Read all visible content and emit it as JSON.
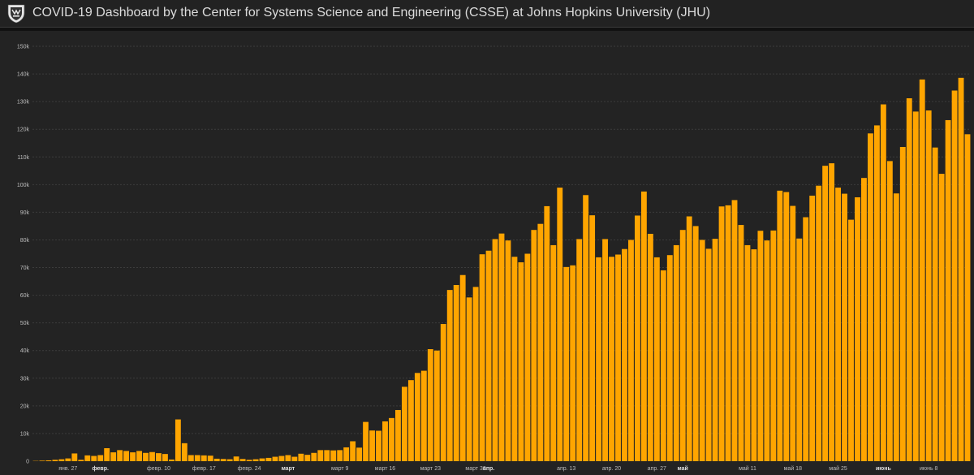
{
  "header": {
    "title": "COVID-19 Dashboard by the Center for Systems Science and Engineering (CSSE) at Johns Hopkins University (JHU)",
    "logo_icon": "jhu-shield-icon"
  },
  "colors": {
    "bar": "#FFA500",
    "background": "#232323",
    "header": "#222222"
  },
  "chart_data": {
    "type": "bar",
    "xlabel": "",
    "ylabel": "",
    "ylim": [
      0,
      150000
    ],
    "grid": true,
    "y_ticks": [
      {
        "value": 0,
        "label": "0"
      },
      {
        "value": 10000,
        "label": "10k"
      },
      {
        "value": 20000,
        "label": "20k"
      },
      {
        "value": 30000,
        "label": "30k"
      },
      {
        "value": 40000,
        "label": "40k"
      },
      {
        "value": 50000,
        "label": "50k"
      },
      {
        "value": 60000,
        "label": "60k"
      },
      {
        "value": 70000,
        "label": "70k"
      },
      {
        "value": 80000,
        "label": "80k"
      },
      {
        "value": 90000,
        "label": "90k"
      },
      {
        "value": 100000,
        "label": "100k"
      },
      {
        "value": 110000,
        "label": "110k"
      },
      {
        "value": 120000,
        "label": "120k"
      },
      {
        "value": 130000,
        "label": "130k"
      },
      {
        "value": 140000,
        "label": "140k"
      },
      {
        "value": 150000,
        "label": "150k"
      }
    ],
    "x_ticks": [
      {
        "index": 5,
        "label": "янв. 27",
        "bold": false
      },
      {
        "index": 10,
        "label": "февр.",
        "bold": true
      },
      {
        "index": 19,
        "label": "февр. 10",
        "bold": false
      },
      {
        "index": 26,
        "label": "февр. 17",
        "bold": false
      },
      {
        "index": 33,
        "label": "февр. 24",
        "bold": false
      },
      {
        "index": 39,
        "label": "март",
        "bold": true
      },
      {
        "index": 47,
        "label": "март 9",
        "bold": false
      },
      {
        "index": 54,
        "label": "март 16",
        "bold": false
      },
      {
        "index": 61,
        "label": "март 23",
        "bold": false
      },
      {
        "index": 68,
        "label": "март 30",
        "bold": false
      },
      {
        "index": 70,
        "label": "апр.",
        "bold": true
      },
      {
        "index": 82,
        "label": "апр. 13",
        "bold": false
      },
      {
        "index": 89,
        "label": "апр. 20",
        "bold": false
      },
      {
        "index": 96,
        "label": "апр. 27",
        "bold": false
      },
      {
        "index": 100,
        "label": "май",
        "bold": true
      },
      {
        "index": 110,
        "label": "май 11",
        "bold": false
      },
      {
        "index": 117,
        "label": "май 18",
        "bold": false
      },
      {
        "index": 124,
        "label": "май 25",
        "bold": false
      },
      {
        "index": 131,
        "label": "июнь",
        "bold": true
      },
      {
        "index": 138,
        "label": "июнь 8",
        "bold": false
      }
    ],
    "values": [
      100,
      200,
      300,
      500,
      700,
      1000,
      2800,
      500,
      2100,
      1900,
      2200,
      4700,
      3200,
      4000,
      3700,
      3200,
      3700,
      3000,
      3300,
      2900,
      2600,
      600,
      15100,
      6500,
      2200,
      2200,
      2100,
      2000,
      900,
      800,
      700,
      1700,
      800,
      500,
      700,
      1000,
      1200,
      1600,
      1900,
      2200,
      1600,
      2700,
      2300,
      3000,
      4000,
      4000,
      3900,
      4000,
      5000,
      7200,
      4900,
      14200,
      11100,
      11000,
      14400,
      15600,
      18500,
      26900,
      29300,
      31900,
      32700,
      40500,
      40000,
      49600,
      61900,
      63700,
      67300,
      59200,
      63000,
      74800,
      76100,
      80300,
      82300,
      79800,
      73900,
      71900,
      75000,
      83600,
      85800,
      92200,
      78100,
      98900,
      70200,
      70800,
      80300,
      96200,
      88900,
      73700,
      80300,
      73900,
      74700,
      76700,
      80000,
      88800,
      97500,
      82200,
      73700,
      69000,
      74500,
      78100,
      83600,
      88500,
      85000,
      80000,
      76800,
      80400,
      92100,
      92500,
      94400,
      85400,
      78100,
      76600,
      83300,
      79800,
      83400,
      97800,
      97300,
      92300,
      80500,
      88200,
      96000,
      99600,
      106800,
      107700,
      98900,
      96700,
      87300,
      95400,
      102400,
      118500,
      121400,
      129000,
      108500,
      96800,
      113600,
      131200,
      126400,
      138000,
      126800,
      113400,
      103900,
      123300,
      134000,
      138600,
      118200
    ]
  }
}
